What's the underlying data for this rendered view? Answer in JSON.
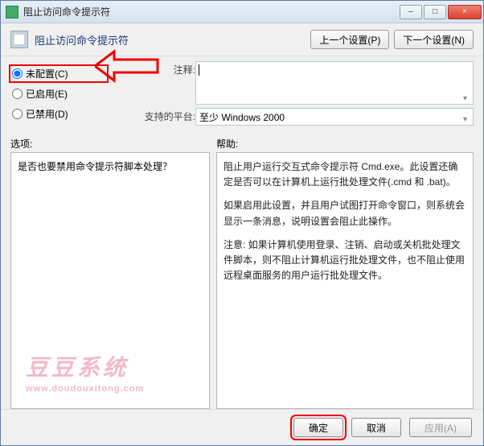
{
  "title": "阻止访问命令提示符",
  "header": {
    "title": "阻止访问命令提示符",
    "prev": "上一个设置(P)",
    "next": "下一个设置(N)"
  },
  "radios": {
    "not_configured": "未配置(C)",
    "enabled": "已启用(E)",
    "disabled": "已禁用(D)"
  },
  "fields": {
    "comment_label": "注释:",
    "comment_value": "",
    "platform_label": "支持的平台:",
    "platform_value": "至少 Windows 2000"
  },
  "panes": {
    "options_label": "选项:",
    "help_label": "帮助:",
    "options_text": "是否也要禁用命令提示符脚本处理？",
    "help_p1": "阻止用户运行交互式命令提示符 Cmd.exe。此设置还确定是否可以在计算机上运行批处理文件(.cmd 和 .bat)。",
    "help_p2": "如果启用此设置，并且用户试图打开命令窗口，则系统会显示一条消息，说明设置会阻止此操作。",
    "help_p3": "注意: 如果计算机使用登录、注销、启动或关机批处理文件脚本，则不阻止计算机运行批处理文件，也不阻止使用远程桌面服务的用户运行批处理文件。"
  },
  "footer": {
    "ok": "确定",
    "cancel": "取消",
    "apply": "应用(A)"
  },
  "watermark": {
    "line1": "豆豆系统",
    "line2": "www.doudouxitong.com"
  },
  "winbtns": {
    "min": "–",
    "max": "□",
    "close": "×"
  }
}
